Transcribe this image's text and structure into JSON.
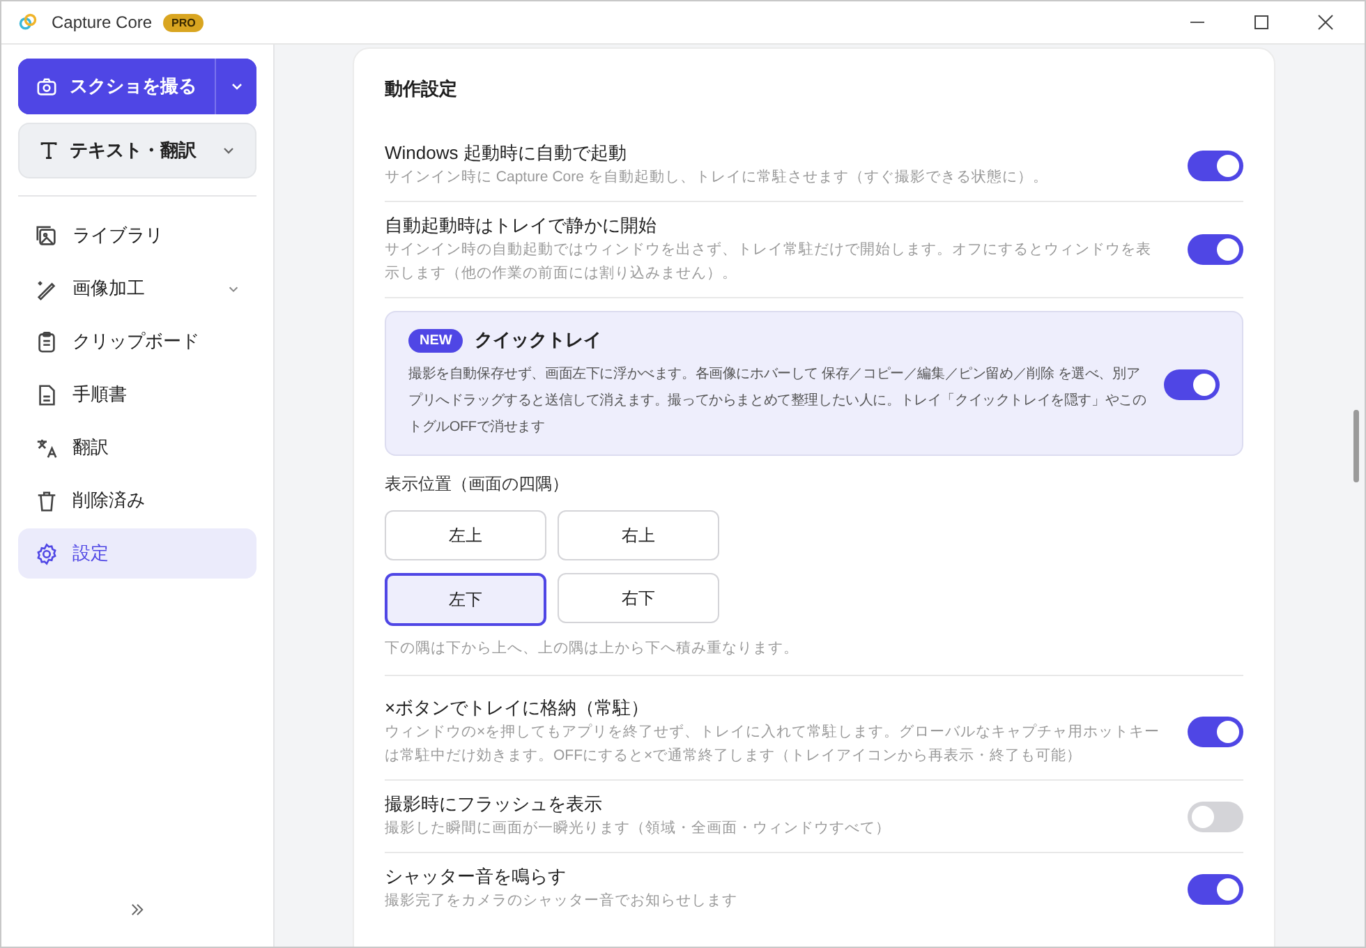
{
  "window": {
    "title": "Capture Core",
    "badge": "PRO"
  },
  "sidebar": {
    "capture_button": {
      "label": "スクショを撮る"
    },
    "text_button": {
      "label": "テキスト・翻訳"
    },
    "items": [
      {
        "label": "ライブラリ",
        "expandable": false,
        "selected": false
      },
      {
        "label": "画像加工",
        "expandable": true,
        "selected": false
      },
      {
        "label": "クリップボード",
        "expandable": false,
        "selected": false
      },
      {
        "label": "手順書",
        "expandable": false,
        "selected": false
      },
      {
        "label": "翻訳",
        "expandable": false,
        "selected": false
      },
      {
        "label": "削除済み",
        "expandable": false,
        "selected": false
      },
      {
        "label": "設定",
        "expandable": false,
        "selected": true
      }
    ]
  },
  "section": {
    "title": "動作設定",
    "settings": [
      {
        "kind": "toggle",
        "title": "Windows 起動時に自動で起動",
        "description": "サインイン時に Capture Core を自動起動し、トレイに常駐させます（すぐ撮影できる状態に）。",
        "on": true
      },
      {
        "kind": "toggle",
        "title": "自動起動時はトレイで静かに開始",
        "description": "サインイン時の自動起動ではウィンドウを出さず、トレイ常駐だけで開始します。オフにするとウィンドウを表示します（他の作業の前面には割り込みません）。",
        "on": true
      },
      {
        "kind": "feature",
        "badge": "NEW",
        "title": "クイックトレイ",
        "description": "撮影を自動保存せず、画面左下に浮かべます。各画像にホバーして 保存／コピー／編集／ピン留め／削除 を選べ、別アプリへドラッグすると送信して消えます。撮ってからまとめて整理したい人に。トレイ「クイックトレイを隠す」やこのトグルOFFで消せます",
        "on": true
      },
      {
        "kind": "position",
        "title": "表示位置（画面の四隅）",
        "options": [
          {
            "label": "左上",
            "selected": false
          },
          {
            "label": "右上",
            "selected": false
          },
          {
            "label": "左下",
            "selected": true
          },
          {
            "label": "右下",
            "selected": false
          }
        ],
        "hint": "下の隅は下から上へ、上の隅は上から下へ積み重なります。"
      },
      {
        "kind": "toggle",
        "title": "×ボタンでトレイに格納（常駐）",
        "description": "ウィンドウの×を押してもアプリを終了せず、トレイに入れて常駐します。グローバルなキャプチャ用ホットキーは常駐中だけ効きます。OFFにすると×で通常終了します（トレイアイコンから再表示・終了も可能）",
        "on": true
      },
      {
        "kind": "toggle",
        "title": "撮影時にフラッシュを表示",
        "description": "撮影した瞬間に画面が一瞬光ります（領域・全画面・ウィンドウすべて）",
        "on": false
      },
      {
        "kind": "toggle",
        "title": "シャッター音を鳴らす",
        "description": "撮影完了をカメラのシャッター音でお知らせします",
        "on": true
      }
    ]
  }
}
